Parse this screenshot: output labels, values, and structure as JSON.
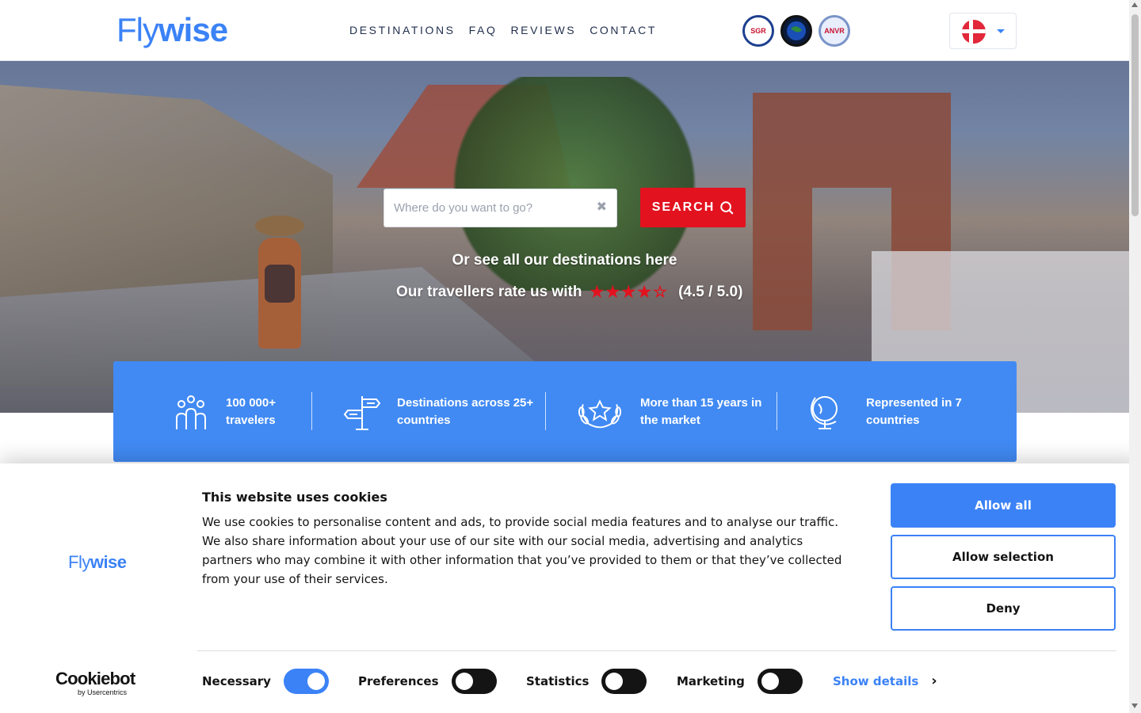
{
  "header": {
    "logo": {
      "part1": "Fly",
      "part2": "wise"
    },
    "nav": [
      "DESTINATIONS",
      "FAQ",
      "REVIEWS",
      "CONTACT"
    ],
    "badges": [
      "SGR",
      "Calamiteitenfonds",
      "ANVR"
    ],
    "language": {
      "selected": "Danish",
      "flag_icon": "denmark-flag-icon"
    }
  },
  "hero": {
    "search": {
      "placeholder": "Where do you want to go?",
      "button_label": "SEARCH"
    },
    "see_all": "Or see all our destinations here",
    "rating": {
      "text": "Our travellers rate us with",
      "score": "(4.5 / 5.0)",
      "value": 4.5,
      "max": 5
    }
  },
  "stats": [
    {
      "icon": "group-icon",
      "line1": "100 000+",
      "line2": "travelers"
    },
    {
      "icon": "signpost-icon",
      "line1": "Destinations across 25+",
      "line2": "countries"
    },
    {
      "icon": "laurel-star-icon",
      "line1": "More than 15 years in",
      "line2": "the market"
    },
    {
      "icon": "globe-icon",
      "line1": "Represented in 7",
      "line2": "countries"
    }
  ],
  "cookie_banner": {
    "logo": {
      "part1": "Fly",
      "part2": "wise"
    },
    "title": "This website uses cookies",
    "body": "We use cookies to personalise content and ads, to provide social media features and to analyse our traffic. We also share information about your use of our site with our social media, advertising and analytics partners who may combine it with other information that you’ve provided to them or that they’ve collected from your use of their services.",
    "buttons": {
      "allow_all": "Allow all",
      "allow_selection": "Allow selection",
      "deny": "Deny"
    },
    "toggles": [
      {
        "label": "Necessary",
        "on": true
      },
      {
        "label": "Preferences",
        "on": false
      },
      {
        "label": "Statistics",
        "on": false
      },
      {
        "label": "Marketing",
        "on": false
      }
    ],
    "show_details": "Show details",
    "cookiebot": {
      "main": "Cookiebot",
      "sub": "by Usercentrics"
    }
  },
  "colors": {
    "brand_blue": "#418af3",
    "accent_red": "#e3121f",
    "toggle_on": "#3b82f6",
    "toggle_off": "#141414"
  }
}
